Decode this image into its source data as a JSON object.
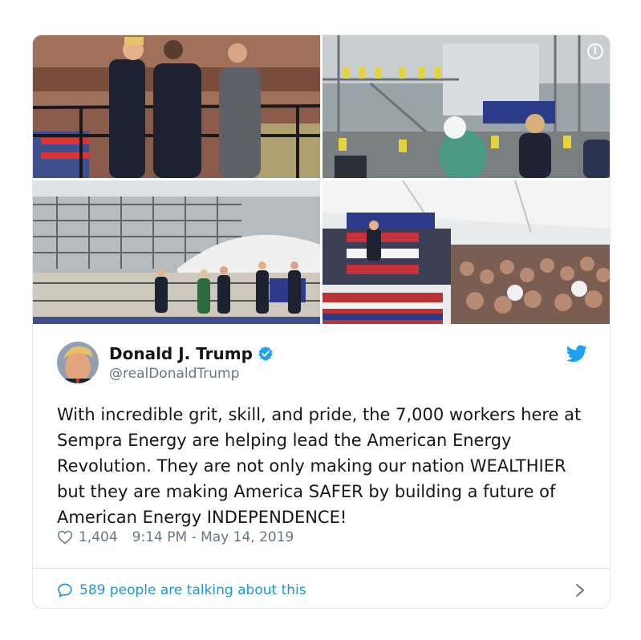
{
  "tweet": {
    "author_name": "Donald J. Trump",
    "handle": "@realDonaldTrump",
    "text": "With incredible grit, skill, and pride, the 7,000 workers here at Sempra Energy are helping lead the American Energy Revolution. They are not only making our nation WEALTHIER but they are making America SAFER by building a future of American Energy INDEPENDENCE!",
    "likes": "1,404",
    "timestamp": "9:14 PM - May 14, 2019",
    "talking": "589 people are talking about this"
  },
  "icons": {
    "verified": "verified-badge-icon",
    "bird": "twitter-bird-icon",
    "heart": "heart-icon",
    "bubble": "speech-bubble-icon",
    "chevron": "chevron-right-icon",
    "info": "info-icon"
  },
  "colors": {
    "accent": "#1da1f2",
    "link": "#1b95e0",
    "muted": "#657786",
    "text": "#14171a",
    "border": "#e1e8ed"
  },
  "media": {
    "photos": [
      "photo-1",
      "photo-2",
      "photo-3",
      "photo-4"
    ],
    "info_glyph": "i"
  }
}
